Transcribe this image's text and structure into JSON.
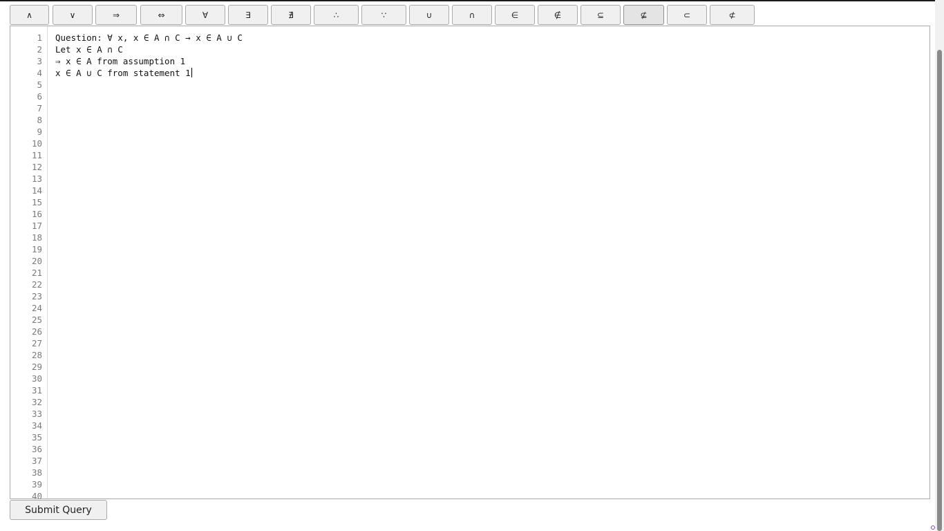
{
  "toolbar": {
    "buttons": [
      "∧",
      "∨",
      "⇒",
      "⇔",
      "∀",
      "∃",
      "∄",
      "∴",
      "∵",
      "∪",
      "∩",
      "∈",
      "∉",
      "⊆",
      "⊈",
      "⊂",
      "⊄"
    ]
  },
  "editor": {
    "line_numbers": [
      "1",
      "2",
      "3",
      "4",
      "5",
      "6",
      "7",
      "8",
      "9",
      "10",
      "11",
      "12",
      "13",
      "14",
      "15",
      "16",
      "17",
      "18",
      "19",
      "20",
      "21",
      "22",
      "23",
      "24",
      "25",
      "26",
      "27",
      "28",
      "29",
      "30",
      "31",
      "32",
      "33",
      "34",
      "35",
      "36",
      "37",
      "38",
      "39",
      "40"
    ],
    "lines": [
      "Question: ∀ x, x ∈ A ∩ C → x ∈ A ∪ C",
      "Let x ∈ A ∩ C",
      "⇒ x ∈ A from assumption 1",
      "x ∈ A ∪ C from statement 1"
    ]
  },
  "submit": {
    "label": "Submit Query"
  }
}
